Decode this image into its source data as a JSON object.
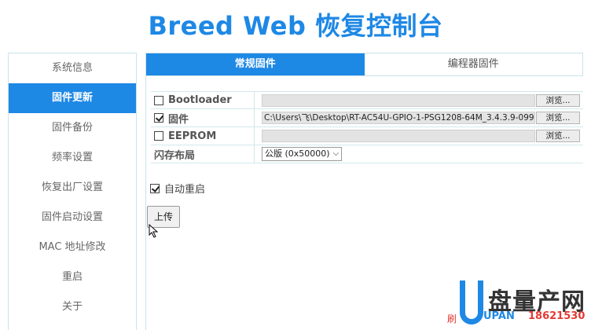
{
  "header": {
    "title": "Breed Web 恢复控制台"
  },
  "sidebar": {
    "items": [
      {
        "label": "系统信息"
      },
      {
        "label": "固件更新"
      },
      {
        "label": "固件备份"
      },
      {
        "label": "频率设置"
      },
      {
        "label": "恢复出厂设置"
      },
      {
        "label": "固件启动设置"
      },
      {
        "label": "MAC 地址修改"
      },
      {
        "label": "重启"
      },
      {
        "label": "关于"
      }
    ],
    "active_index": 1
  },
  "tabs": [
    {
      "label": "常规固件",
      "active": true
    },
    {
      "label": "编程器固件",
      "active": false
    }
  ],
  "form": {
    "bootloader": {
      "label": "Bootloader",
      "checked": false,
      "path": "",
      "browse_label": "浏览..."
    },
    "firmware": {
      "label": "固件",
      "checked": true,
      "path": "C:\\Users\\飞\\Desktop\\RT-AC54U-GPIO-1-PSG1208-64M_3.4.3.9-099",
      "browse_label": "浏览..."
    },
    "eeprom": {
      "label": "EEPROM",
      "checked": false,
      "path": "",
      "browse_label": "浏览..."
    },
    "flash_layout": {
      "label": "闪存布局",
      "selected": "公版 (0x50000)"
    }
  },
  "auto_reboot": {
    "label": "自动重启",
    "checked": true
  },
  "upload_button": {
    "label": "上传"
  },
  "watermark": {
    "brand": "盘量产网",
    "url": "UPAN",
    "phone": "18621530",
    "prefix": "刷"
  },
  "colors": {
    "accent": "#1e88e5",
    "border": "#c9e4ea"
  }
}
